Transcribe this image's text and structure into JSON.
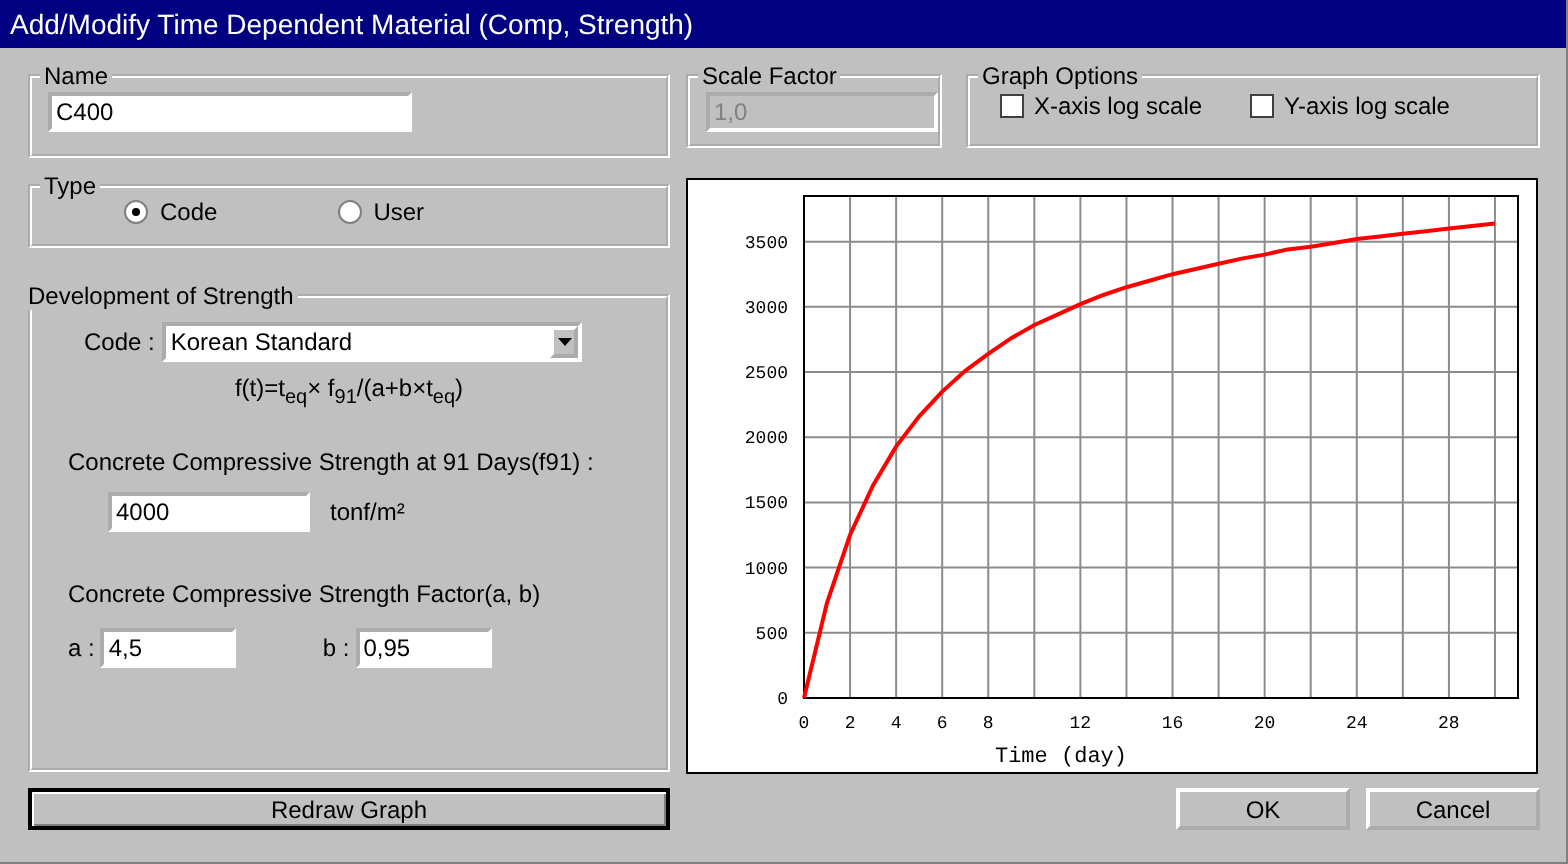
{
  "window": {
    "title": "Add/Modify Time Dependent Material (Comp, Strength)"
  },
  "name_group": {
    "label": "Name",
    "value": "C400"
  },
  "type_group": {
    "label": "Type",
    "options": [
      {
        "label": "Code",
        "selected": true
      },
      {
        "label": "User",
        "selected": false
      }
    ]
  },
  "development": {
    "label": "Development of Strength",
    "code_label": "Code :",
    "code_value": "Korean Standard",
    "formula": "f(t)=t$_{eq}$× f$_{91}$/(a+b×t$_{eq}$)",
    "strength_label": "Concrete Compressive Strength at 91 Days(f91) :",
    "strength_value": "4000",
    "strength_unit": "tonf/m²",
    "factor_label": "Concrete Compressive Strength Factor(a, b)",
    "a_label": "a :",
    "a_value": "4,5",
    "b_label": "b :",
    "b_value": "0,95"
  },
  "redraw_button": "Redraw Graph",
  "scale_factor": {
    "label": "Scale Factor",
    "value": "1,0",
    "disabled": true
  },
  "graph_options": {
    "label": "Graph Options",
    "options": [
      {
        "label": "X-axis log scale",
        "checked": false
      },
      {
        "label": "Y-axis log scale",
        "checked": false
      }
    ]
  },
  "chart_data": {
    "type": "line",
    "xlabel": "Time (day)",
    "x": [
      0,
      1,
      2,
      3,
      4,
      5,
      6,
      7,
      8,
      9,
      10,
      11,
      12,
      13,
      14,
      15,
      16,
      17,
      18,
      19,
      20,
      21,
      22,
      23,
      24,
      25,
      26,
      27,
      28,
      29,
      30
    ],
    "series": [
      {
        "color": "#ff0000",
        "values": [
          0,
          730,
          1250,
          1630,
          1930,
          2160,
          2350,
          2510,
          2640,
          2760,
          2860,
          2940,
          3020,
          3090,
          3150,
          3200,
          3250,
          3290,
          3330,
          3370,
          3400,
          3440,
          3460,
          3490,
          3520,
          3540,
          3560,
          3580,
          3600,
          3620,
          3640
        ]
      }
    ],
    "grid": true,
    "xlim": [
      0,
      31
    ],
    "ylim": [
      0,
      3850
    ],
    "xticks": [
      0,
      2,
      4,
      6,
      8,
      12,
      16,
      20,
      24,
      28
    ],
    "yticks": [
      0,
      500,
      1000,
      1500,
      2000,
      2500,
      3000,
      3500
    ]
  },
  "buttons": [
    "OK",
    "Cancel"
  ]
}
